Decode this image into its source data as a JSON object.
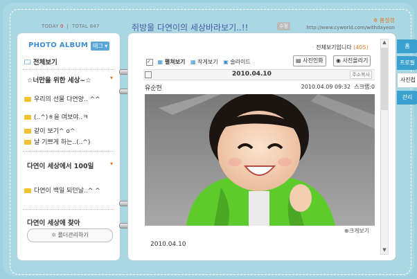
{
  "header": {
    "today_label": "TODAY",
    "today_count": "0",
    "total_label": "TOTAL",
    "total_count": "847",
    "title": "쥐방울 다연이의 세상바라보기..!!",
    "title_badge": "수정",
    "setting": "홈설정",
    "url": "http://www.cyworld.com/withdayeon"
  },
  "sidebar": {
    "album_title": "PHOTO ALBUM",
    "tag_btn": "태그",
    "view_all": "전체보기",
    "section1": "☆너만을 위한 세상~☆",
    "items1": [
      "우리의 선물 다연양.. ^^",
      "(..^)ㅎ을 여보야..ㅋ",
      "같이 보기^ o^",
      "날 기쁘게 하는..(..^)"
    ],
    "section2": "다연이 세상에서 100일",
    "items2": [
      "다연이 백일 되던날..^ ^"
    ],
    "section3": "다연이 세상에 찾아",
    "folder_mgmt": "폴더관리하기"
  },
  "content": {
    "view_all_text": "전체보기입니다",
    "view_all_count": "(405)",
    "toolbar": {
      "view_all": "펼쳐보기",
      "small_view": "작게보기",
      "slide": "슬라이드",
      "print_btn": "사진인화",
      "upload_btn": "사진올리기"
    },
    "date": "2010.04.10",
    "copy_address": "주소복사",
    "author": "유순현",
    "timestamp": "2010.04.09 09:32",
    "scrap": "스크랩:0",
    "zoom": "크게보기",
    "caption": "2010.04.10"
  },
  "tabs": [
    "홈",
    "프로필",
    "사진첩",
    "관리"
  ]
}
